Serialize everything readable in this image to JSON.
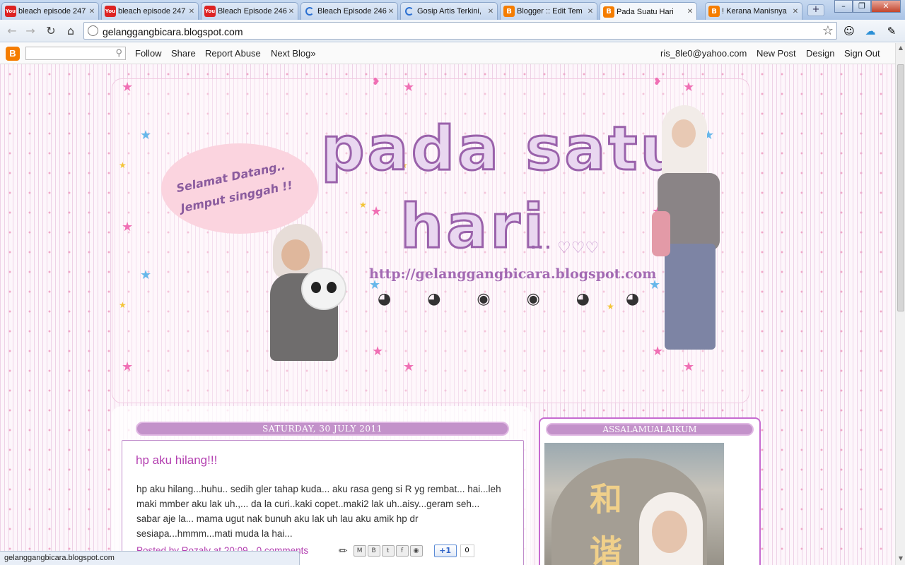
{
  "browser": {
    "tabs": [
      {
        "title": "bleach episode 247",
        "icon": "youtube-icon"
      },
      {
        "title": "bleach episode 247",
        "icon": "youtube-icon"
      },
      {
        "title": "Bleach Episode 246",
        "icon": "youtube-icon"
      },
      {
        "title": "Bleach Episode 246",
        "icon": "loading-icon"
      },
      {
        "title": "Gosip Artis Terkini,",
        "icon": "loading-icon"
      },
      {
        "title": "Blogger :: Edit Tem",
        "icon": "blogger-icon"
      },
      {
        "title": "Pada Suatu Hari",
        "icon": "blogger-icon",
        "active": true
      },
      {
        "title": "! Kerana Manisnya",
        "icon": "blogger-icon"
      }
    ],
    "address": "gelanggangbicara.blogspot.com",
    "status_url": "gelanggangbicara.blogspot.com"
  },
  "navbar": {
    "search_placeholder": "",
    "links": {
      "follow": "Follow",
      "share": "Share",
      "report": "Report Abuse",
      "next": "Next Blog»",
      "email": "ris_8le0@yahoo.com",
      "new_post": "New Post",
      "design": "Design",
      "sign_out": "Sign Out"
    }
  },
  "header": {
    "bubble_line1": "Selamat Datang..",
    "bubble_line2": "Jemput singgah !!",
    "title_line1": "pada satu",
    "title_line2": "hari",
    "title_dots": "...",
    "title_hearts": "♡♡♡",
    "url_art": "http://gelanggangbicara.blogspot.com"
  },
  "post": {
    "date": "SATURDAY, 30 JULY 2011",
    "title": "hp aku hilang!!!",
    "body": "hp aku hilang...huhu.. sedih gler tahap kuda... aku rasa geng si R yg rembat... hai...leh maki mmber aku lak uh.,... da la curi..kaki copet..maki2 lak uh..aisy...geram seh... sabar aje la... mama ugut nak bunuh aku lak uh lau aku amik hp dr sesiapa...hmmm...mati muda la hai...",
    "footer": "Posted by Rozaly at 20:09 · 0 comments",
    "plus_one": "+1",
    "plus_count": "0"
  },
  "sidebar": {
    "widget_title": "ASSALAMUALAIKUM"
  },
  "colors": {
    "accent": "#c392ca",
    "post_title": "#b33fb0",
    "border": "#c66ad0"
  }
}
